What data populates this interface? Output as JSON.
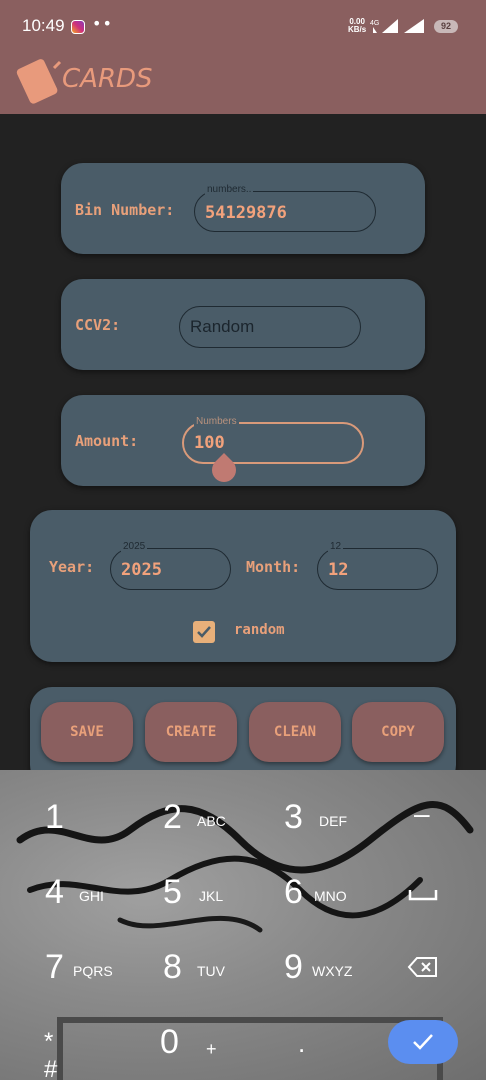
{
  "status_bar": {
    "time": "10:49",
    "dots": "••",
    "net_speed_value": "0.00",
    "net_speed_unit": "KB/s",
    "battery": "92"
  },
  "app_bar": {
    "title": "CARDS"
  },
  "bin": {
    "label": "Bin Number:",
    "hint": "numbers..",
    "value": "54129876"
  },
  "ccv": {
    "label": "CCV2:",
    "value": "Random"
  },
  "amount": {
    "label": "Amount:",
    "hint": "Numbers",
    "value": "100"
  },
  "date": {
    "year_label": "Year:",
    "year_hint": "2025",
    "year_value": "2025",
    "month_label": "Month:",
    "month_hint": "12",
    "month_value": "12",
    "random_label": "random",
    "random_checked": true
  },
  "actions": {
    "save": "SAVE",
    "create": "CREATE",
    "clean": "CLEAN",
    "copy": "COPY"
  },
  "keyboard": {
    "k1": "1",
    "k2": "2",
    "k2l": "ABC",
    "k3": "3",
    "k3l": "DEF",
    "kminus": "–",
    "k4": "4",
    "k4l": "GHI",
    "k5": "5",
    "k5l": "JKL",
    "k6": "6",
    "k6l": "MNO",
    "k7": "7",
    "k7l": "PQRS",
    "k8": "8",
    "k8l": "TUV",
    "k9": "9",
    "k9l": "WXYZ",
    "kstarhash": "* #",
    "k0": "0",
    "k0l": "+",
    "kdot": "."
  },
  "colors": {
    "accent": "#e8a07a",
    "app_bar": "#8a5f5f",
    "card": "#4a5c68",
    "background": "#222222",
    "confirm_key": "#5b8ef0"
  }
}
